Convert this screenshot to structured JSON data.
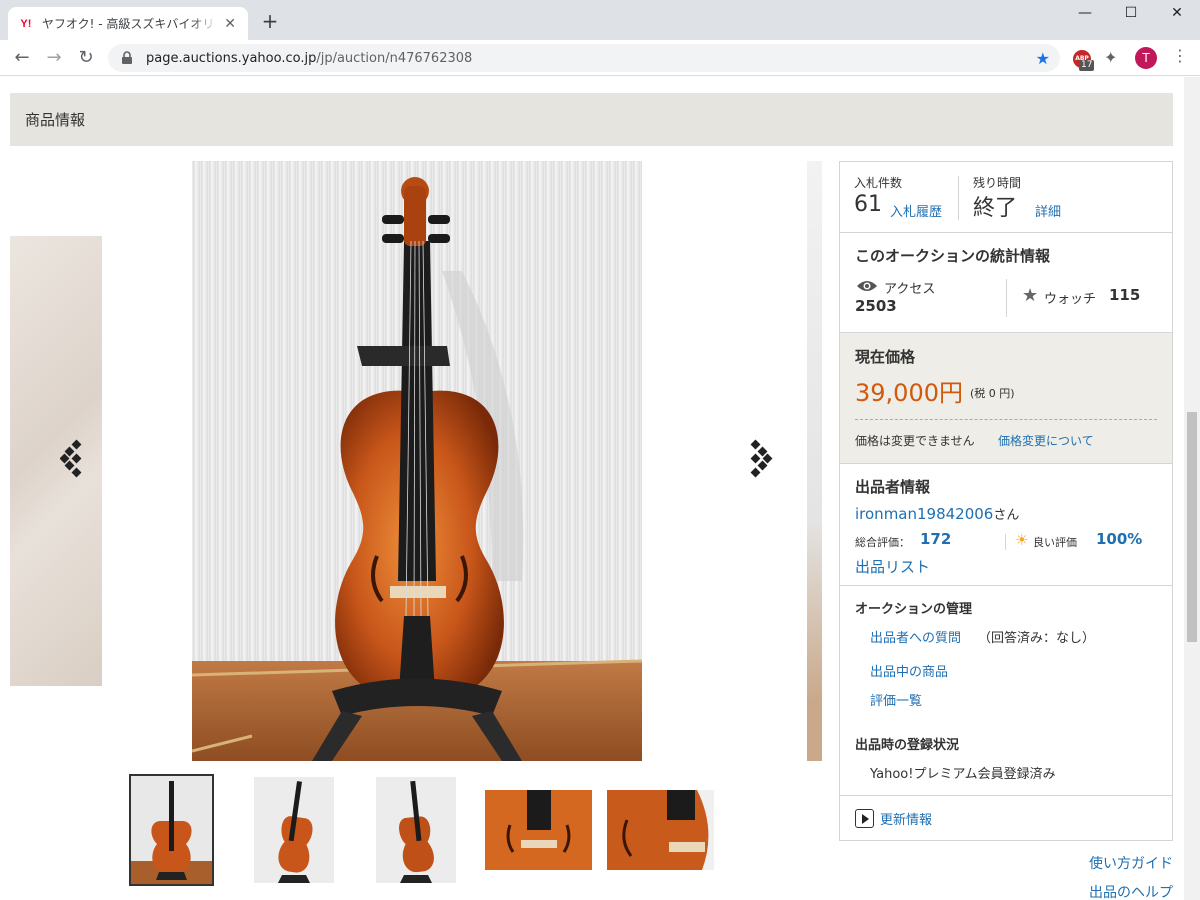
{
  "browser": {
    "tab_title": "ヤフオク! - 高級スズキバイオリン No.5",
    "tab_favicon": "Y!",
    "tab_close": "✕",
    "new_tab": "+",
    "url_host": "page.auctions.yahoo.co.jp",
    "url_path": "/jp/auction/n476762308",
    "extension_badge": "17",
    "extension_abp": "ABP",
    "profile_initial": "T",
    "window_controls": {
      "minimize": "—",
      "maximize": "☐",
      "close": "✕"
    },
    "nav": {
      "back": "←",
      "forward": "→",
      "reload": "↻"
    },
    "icons": {
      "bookmark": "star-icon",
      "extensions": "puzzle-icon",
      "menu": "kebab-icon"
    }
  },
  "page": {
    "section_title": "商品情報",
    "gallery": {
      "thumbnail_count": 5,
      "active_index": 0,
      "icons": {
        "prev": "chevron-left-icon",
        "next": "chevron-right-icon"
      }
    },
    "panel": {
      "bids": {
        "label": "入札件数",
        "count": "61",
        "history_link": "入札履歴"
      },
      "time": {
        "label": "残り時間",
        "value": "終了",
        "detail_link": "詳細"
      },
      "stats": {
        "title": "このオークションの統計情報",
        "access_label": "アクセス",
        "access_value": "2503",
        "watch_label": "ウォッチ",
        "watch_value": "115"
      },
      "price": {
        "title": "現在価格",
        "value": "39,000円",
        "tax": "(税 0 円)",
        "note": "価格は変更できません",
        "link": "価格変更について"
      },
      "seller": {
        "title": "出品者情報",
        "name": "ironman19842006",
        "suffix": "さん",
        "rating_label": "総合評価：",
        "rating_value": "172",
        "good_label": "良い評価",
        "good_value": "100%",
        "list_link": "出品リスト"
      },
      "management": {
        "title": "オークションの管理",
        "question_link": "出品者への質問",
        "question_note": "（回答済み：なし）",
        "items_link": "出品中の商品",
        "eval_link": "評価一覧",
        "registration_title": "出品時の登録状況",
        "registration_value": "Yahoo!プレミアム会員登録済み"
      },
      "update_link": "更新情報"
    },
    "footer_links": {
      "guide": "使い方ガイド",
      "help": "出品のヘルプ"
    }
  },
  "colors": {
    "link": "#1f6fb2",
    "price": "#d0590c",
    "header_bg": "#e6e4de",
    "price_bg": "#eeede7"
  }
}
